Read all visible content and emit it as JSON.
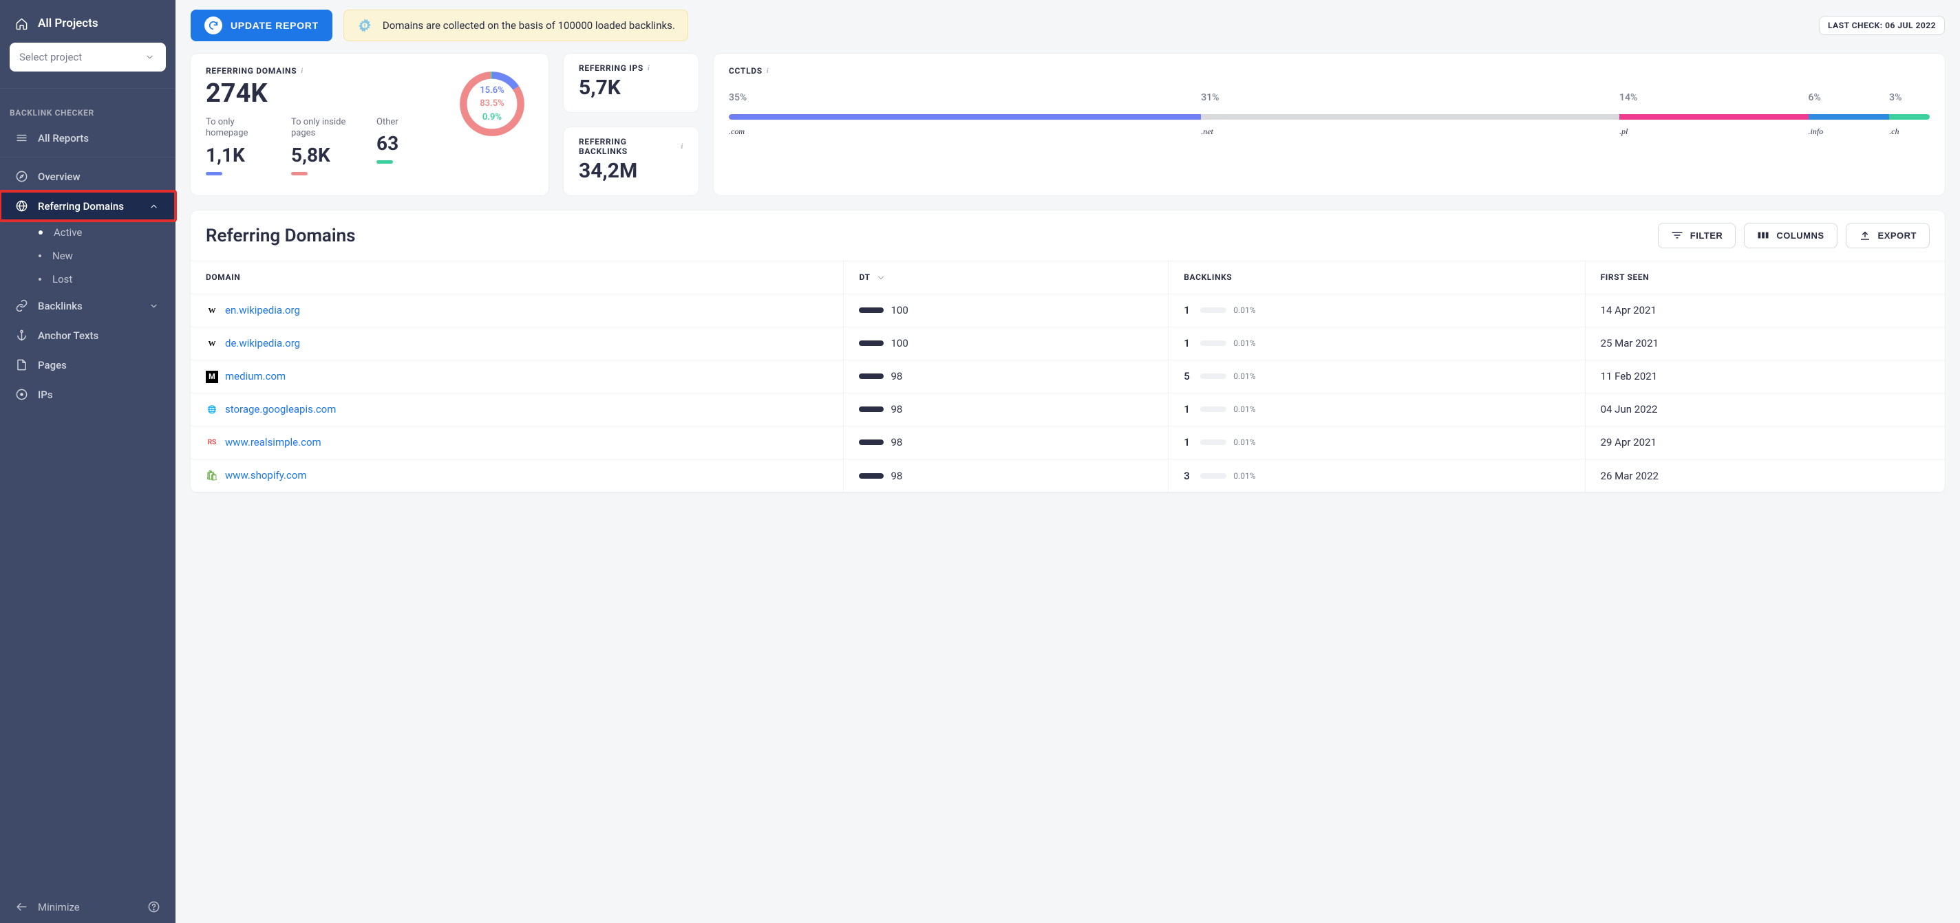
{
  "sidebar": {
    "allProjects": "All Projects",
    "selectPlaceholder": "Select project",
    "sectionLabel": "BACKLINK CHECKER",
    "allReports": "All Reports",
    "nav": {
      "overview": "Overview",
      "referringDomains": "Referring Domains",
      "subActive": "Active",
      "subNew": "New",
      "subLost": "Lost",
      "backlinks": "Backlinks",
      "anchorTexts": "Anchor Texts",
      "pages": "Pages",
      "ips": "IPs"
    },
    "minimize": "Minimize"
  },
  "topbar": {
    "updateBtn": "UPDATE REPORT",
    "notice": "Domains are collected on the basis of 100000 loaded backlinks.",
    "lastCheckLabel": "LAST CHECK: ",
    "lastCheck": "06 JUL 2022"
  },
  "cards": {
    "referringDomains": {
      "title": "REFERRING DOMAINS",
      "value": "274K",
      "homeLbl": "To only homepage",
      "homeVal": "1,1K",
      "insideLbl": "To only inside pages",
      "insideVal": "5,8K",
      "otherLbl": "Other",
      "otherVal": "63",
      "pct1": "15.6%",
      "pct2": "83.5%",
      "pct3": "0.9%"
    },
    "referringIps": {
      "title": "REFERRING IPS",
      "value": "5,7K"
    },
    "referringBacklinks": {
      "title": "REFERRING BACKLINKS",
      "value": "34,2M"
    },
    "cctlds": {
      "title": "CCTLDS",
      "items": [
        {
          "pct": "35%",
          "label": ".com",
          "w": 35,
          "color": "#6d7ff2"
        },
        {
          "pct": "31%",
          "label": ".net",
          "w": 31,
          "color": "#d8dade"
        },
        {
          "pct": "14%",
          "label": ".pl",
          "w": 14,
          "color": "#ef3b8f"
        },
        {
          "pct": "6%",
          "label": ".info",
          "w": 6,
          "color": "#2f8be0"
        },
        {
          "pct": "3%",
          "label": ".ch",
          "w": 3,
          "color": "#3dcf9e"
        }
      ]
    }
  },
  "chart_data": {
    "type": "pie",
    "title": "Referring Domains distribution",
    "series": [
      {
        "name": "To only homepage",
        "value": 15.6,
        "color": "#6d86f5"
      },
      {
        "name": "To only inside pages",
        "value": 83.5,
        "color": "#f08a8a"
      },
      {
        "name": "Other",
        "value": 0.9,
        "color": "#3dcf9e"
      }
    ]
  },
  "table": {
    "title": "Referring Domains",
    "filter": "FILTER",
    "columns": "COLUMNS",
    "export": "EXPORT",
    "headers": {
      "domain": "DOMAIN",
      "dt": "DT",
      "backlinks": "BACKLINKS",
      "firstSeen": "FIRST SEEN"
    },
    "rows": [
      {
        "domain": "en.wikipedia.org",
        "icon": "W",
        "dt": "100",
        "bl": "1",
        "blpct": "0.01%",
        "fs": "14 Apr 2021"
      },
      {
        "domain": "de.wikipedia.org",
        "icon": "W",
        "dt": "100",
        "bl": "1",
        "blpct": "0.01%",
        "fs": "25 Mar 2021"
      },
      {
        "domain": "medium.com",
        "icon": "M",
        "dt": "98",
        "bl": "5",
        "blpct": "0.01%",
        "fs": "11 Feb 2021"
      },
      {
        "domain": "storage.googleapis.com",
        "icon": "G",
        "dt": "98",
        "bl": "1",
        "blpct": "0.01%",
        "fs": "04 Jun 2022"
      },
      {
        "domain": "www.realsimple.com",
        "icon": "RS",
        "dt": "98",
        "bl": "1",
        "blpct": "0.01%",
        "fs": "29 Apr 2021"
      },
      {
        "domain": "www.shopify.com",
        "icon": "S",
        "dt": "98",
        "bl": "3",
        "blpct": "0.01%",
        "fs": "26 Mar 2022"
      }
    ]
  }
}
